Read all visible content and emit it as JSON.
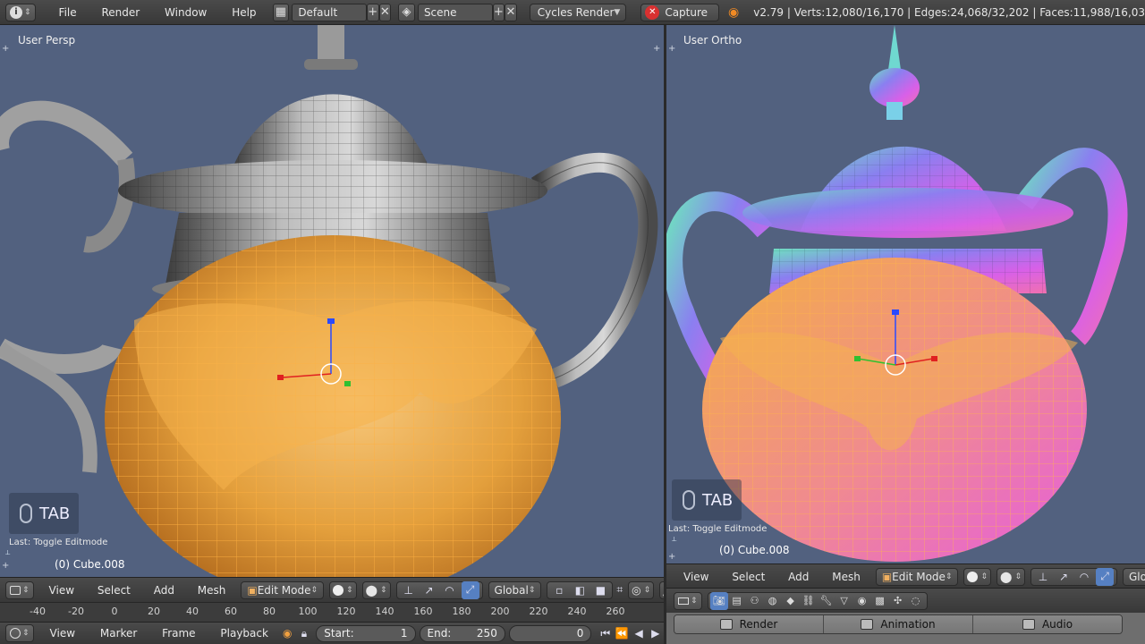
{
  "topbar": {
    "menus": [
      "File",
      "Render",
      "Window",
      "Help"
    ],
    "layout_value": "Default",
    "scene_value": "Scene",
    "engine_value": "Cycles Render",
    "capture_label": "Capture",
    "stats": "v2.79 | Verts:12,080/16,170 | Edges:24,068/32,202 | Faces:11,988/16,03"
  },
  "left_view": {
    "label": "User Persp",
    "tab_key": "TAB",
    "last_op": "Last: Toggle Editmode",
    "object_name": "(0) Cube.008"
  },
  "right_view": {
    "label": "User Ortho",
    "tab_key": "TAB",
    "last_op": "Last: Toggle Editmode",
    "object_name": "(0) Cube.008"
  },
  "view_header": {
    "menus": [
      "View",
      "Select",
      "Add",
      "Mesh"
    ],
    "mode_value": "Edit Mode",
    "orientation_value": "Global"
  },
  "timeline": {
    "ticks": [
      "-40",
      "-20",
      "0",
      "20",
      "40",
      "60",
      "80",
      "100",
      "120",
      "140",
      "160",
      "180",
      "200",
      "220",
      "240",
      "260"
    ],
    "menus": [
      "View",
      "Marker",
      "Frame",
      "Playback"
    ],
    "start_label": "Start:",
    "start_value": "1",
    "end_label": "End:",
    "end_value": "250",
    "current_frame": "0"
  },
  "properties": {
    "tabs": [
      "Render",
      "Animation",
      "Audio"
    ]
  },
  "colors": {
    "viewport_bg": "#52617f",
    "selection_orange": "#f0a63a",
    "active_tool": "#5680c2",
    "header_bg": "#424242"
  }
}
